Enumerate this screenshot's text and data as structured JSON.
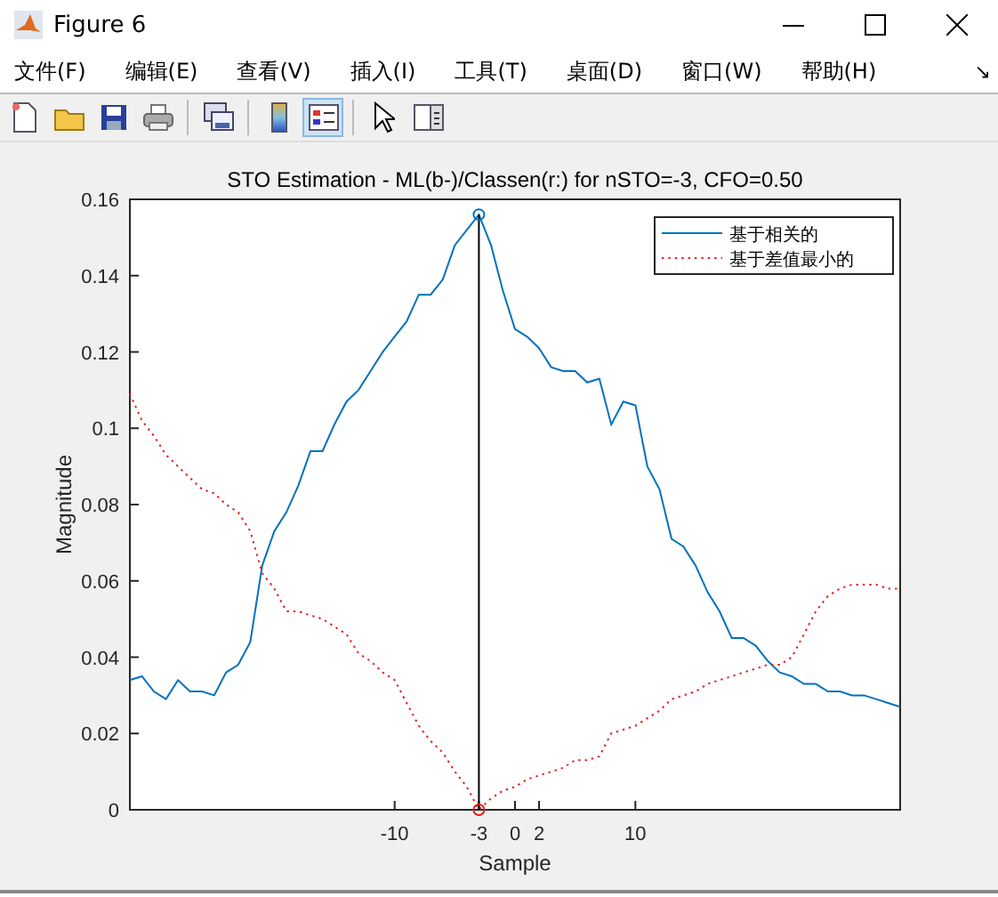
{
  "window": {
    "title": "Figure 6"
  },
  "menu": [
    {
      "label": "文件(F)"
    },
    {
      "label": "编辑(E)"
    },
    {
      "label": "查看(V)"
    },
    {
      "label": "插入(I)"
    },
    {
      "label": "工具(T)"
    },
    {
      "label": "桌面(D)"
    },
    {
      "label": "窗口(W)"
    },
    {
      "label": "帮助(H)"
    }
  ],
  "dock_arrow": "↘",
  "toolbar": [
    {
      "kind": "new",
      "on": false
    },
    {
      "kind": "open",
      "on": false
    },
    {
      "kind": "save",
      "on": false
    },
    {
      "kind": "print",
      "on": false
    },
    {
      "kind": "sep"
    },
    {
      "kind": "link",
      "on": false
    },
    {
      "kind": "sep"
    },
    {
      "kind": "colorbar",
      "on": false
    },
    {
      "kind": "legend",
      "on": true
    },
    {
      "kind": "sep"
    },
    {
      "kind": "pointer",
      "on": false
    },
    {
      "kind": "panel",
      "on": false
    }
  ],
  "chart_data": {
    "type": "line",
    "title": "STO Estimation - ML(b-)/Classen(r:) for nSTO=-3, CFO=0.50",
    "xlabel": "Sample",
    "ylabel": "Magnitude",
    "xlim": [
      -32,
      32
    ],
    "ylim": [
      0,
      0.16
    ],
    "xticks": [
      -10,
      -3,
      0,
      2,
      10
    ],
    "yticks": [
      0,
      0.02,
      0.04,
      0.06,
      0.08,
      0.1,
      0.12,
      0.14,
      0.16
    ],
    "x": [
      -32,
      -31,
      -30,
      -29,
      -28,
      -27,
      -26,
      -25,
      -24,
      -23,
      -22,
      -21,
      -20,
      -19,
      -18,
      -17,
      -16,
      -15,
      -14,
      -13,
      -12,
      -11,
      -10,
      -9,
      -8,
      -7,
      -6,
      -5,
      -4,
      -3,
      -2,
      -1,
      0,
      1,
      2,
      3,
      4,
      5,
      6,
      7,
      8,
      9,
      10,
      11,
      12,
      13,
      14,
      15,
      16,
      17,
      18,
      19,
      20,
      21,
      22,
      23,
      24,
      25,
      26,
      27,
      28,
      29,
      30,
      31,
      32
    ],
    "series": [
      {
        "name": "基于相关的",
        "color": "#0072bd",
        "line_style": "solid",
        "values": [
          0.034,
          0.035,
          0.031,
          0.029,
          0.034,
          0.031,
          0.031,
          0.03,
          0.036,
          0.038,
          0.044,
          0.064,
          0.073,
          0.078,
          0.085,
          0.094,
          0.094,
          0.101,
          0.107,
          0.11,
          0.115,
          0.12,
          0.124,
          0.128,
          0.135,
          0.135,
          0.139,
          0.148,
          0.152,
          0.156,
          0.148,
          0.136,
          0.126,
          0.124,
          0.121,
          0.116,
          0.115,
          0.115,
          0.112,
          0.113,
          0.101,
          0.107,
          0.106,
          0.09,
          0.084,
          0.071,
          0.069,
          0.064,
          0.057,
          0.052,
          0.045,
          0.045,
          0.043,
          0.039,
          0.036,
          0.035,
          0.033,
          0.033,
          0.031,
          0.031,
          0.03,
          0.03,
          0.029,
          0.028,
          0.027
        ]
      },
      {
        "name": "基于差值最小的",
        "color": "#e02020",
        "line_style": "dotted",
        "values": [
          0.109,
          0.102,
          0.098,
          0.093,
          0.09,
          0.087,
          0.084,
          0.083,
          0.08,
          0.078,
          0.073,
          0.062,
          0.058,
          0.052,
          0.052,
          0.051,
          0.05,
          0.048,
          0.046,
          0.041,
          0.039,
          0.036,
          0.034,
          0.028,
          0.022,
          0.018,
          0.015,
          0.01,
          0.006,
          0,
          0.003,
          0.005,
          0.006,
          0.008,
          0.009,
          0.01,
          0.011,
          0.013,
          0.013,
          0.014,
          0.02,
          0.021,
          0.022,
          0.024,
          0.026,
          0.029,
          0.03,
          0.031,
          0.033,
          0.034,
          0.035,
          0.036,
          0.037,
          0.038,
          0.038,
          0.04,
          0.046,
          0.052,
          0.056,
          0.058,
          0.059,
          0.059,
          0.059,
          0.058,
          0.058
        ]
      }
    ],
    "legend": true,
    "ref_lines": [
      {
        "axis": "x",
        "value": -3
      }
    ]
  }
}
